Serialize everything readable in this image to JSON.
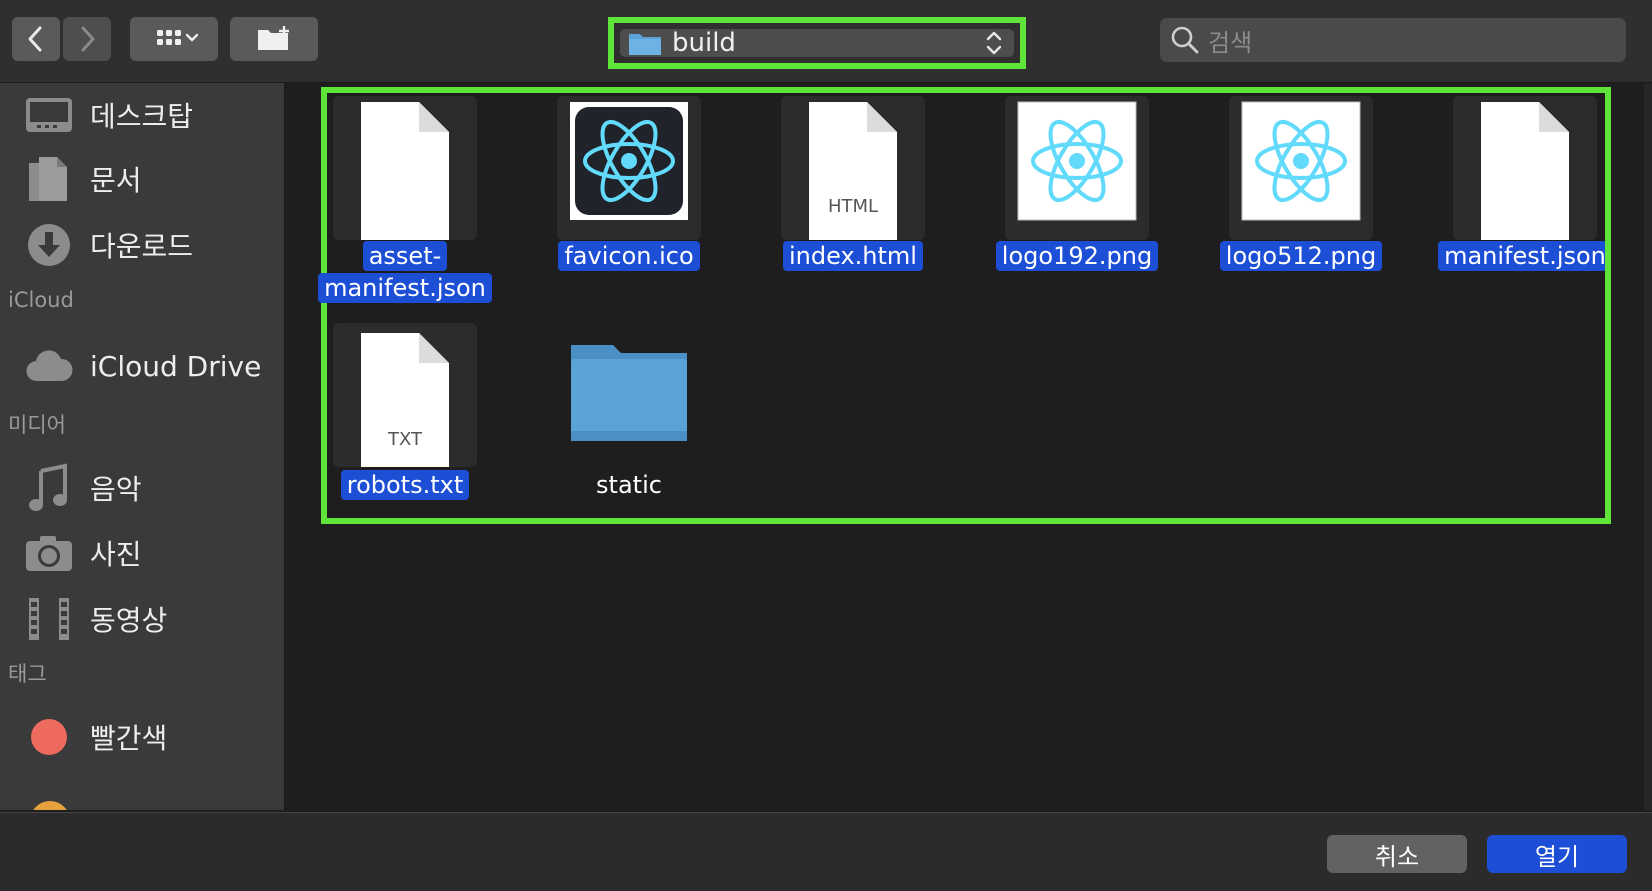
{
  "toolbar": {
    "path": "build",
    "search_placeholder": "검색"
  },
  "sidebar": {
    "favorites": [
      {
        "label": "데스크탑",
        "icon": "desktop-icon"
      },
      {
        "label": "문서",
        "icon": "documents-icon"
      },
      {
        "label": "다운로드",
        "icon": "downloads-icon"
      }
    ],
    "icloud_header": "iCloud",
    "icloud": [
      {
        "label": "iCloud Drive",
        "icon": "cloud-icon"
      }
    ],
    "media_header": "미디어",
    "media": [
      {
        "label": "음악",
        "icon": "music-note-icon"
      },
      {
        "label": "사진",
        "icon": "camera-icon"
      },
      {
        "label": "동영상",
        "icon": "film-icon"
      }
    ],
    "tags_header": "태그",
    "tags": [
      {
        "label": "빨간색",
        "color": "#ef6a5e"
      }
    ]
  },
  "files": [
    {
      "name_line1": "asset-",
      "name_line2": "manifest.json",
      "kind": "document",
      "selected": true
    },
    {
      "name_line1": "favicon.ico",
      "kind": "react-dark",
      "selected": true
    },
    {
      "name_line1": "index.html",
      "kind": "document",
      "type_label": "HTML",
      "selected": true
    },
    {
      "name_line1": "logo192.png",
      "kind": "react-light",
      "selected": true
    },
    {
      "name_line1": "logo512.png",
      "kind": "react-light",
      "selected": true
    },
    {
      "name_line1": "manifest.json",
      "kind": "document",
      "selected": true
    },
    {
      "name_line1": "robots.txt",
      "kind": "document",
      "type_label": "TXT",
      "selected": true
    },
    {
      "name_line1": "static",
      "kind": "folder",
      "selected": false
    }
  ],
  "buttons": {
    "cancel": "취소",
    "open": "열기"
  },
  "colors": {
    "accent": "#1d4fd6",
    "highlight_frame": "#5fe43a",
    "folder": "#5aa3d8",
    "react": "#61dafb"
  }
}
